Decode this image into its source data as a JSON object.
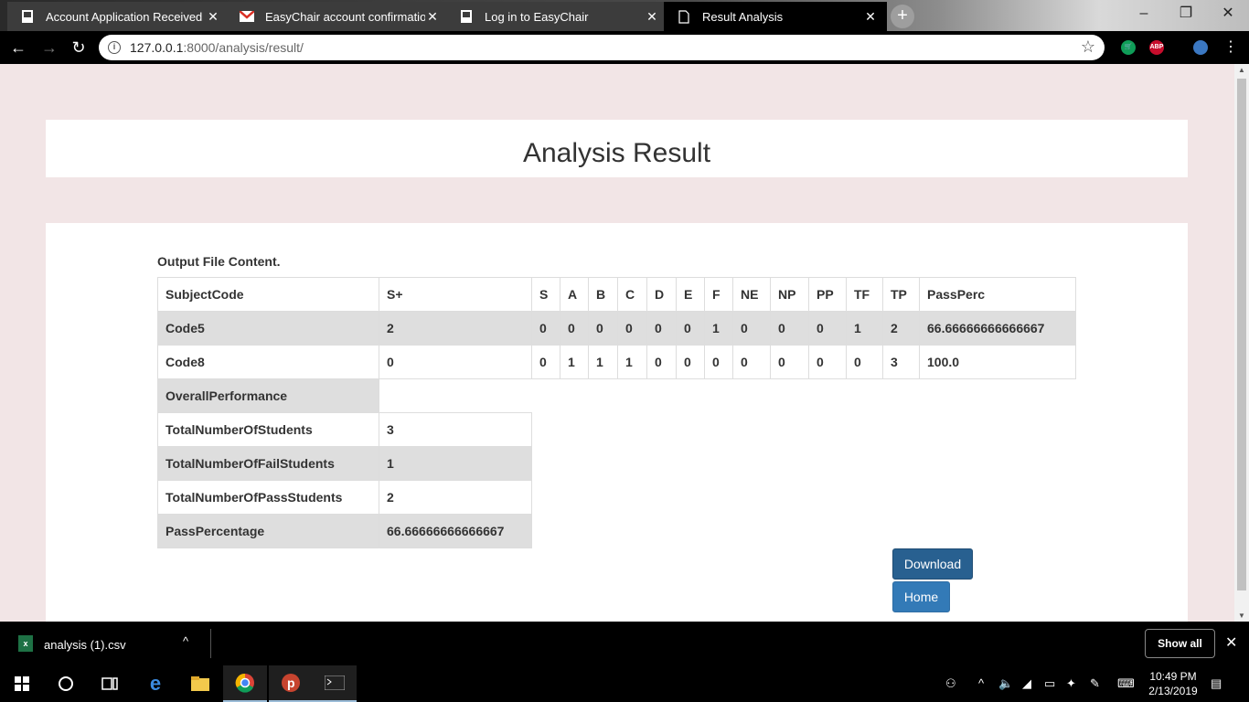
{
  "browser": {
    "tabs": [
      {
        "title": "Account Application Received",
        "icon": "document-icon"
      },
      {
        "title": "EasyChair account confirmation",
        "icon": "gmail-icon"
      },
      {
        "title": "Log in to EasyChair",
        "icon": "document-icon"
      },
      {
        "title": "Result Analysis",
        "icon": "page-icon"
      }
    ],
    "url_host": "127.0.0.1",
    "url_path": ":8000/analysis/result/",
    "ext_abp": "ABP"
  },
  "page": {
    "heading": "Analysis Result",
    "caption": "Output File Content.",
    "table": {
      "headers": [
        "SubjectCode",
        "S+",
        "S",
        "A",
        "B",
        "C",
        "D",
        "E",
        "F",
        "NE",
        "NP",
        "PP",
        "TF",
        "TP",
        "PassPerc"
      ],
      "rows": [
        [
          "Code5",
          "2",
          "0",
          "0",
          "0",
          "0",
          "0",
          "0",
          "1",
          "0",
          "0",
          "0",
          "1",
          "2",
          "66.66666666666667"
        ],
        [
          "Code8",
          "0",
          "0",
          "1",
          "1",
          "1",
          "0",
          "0",
          "0",
          "0",
          "0",
          "0",
          "0",
          "3",
          "100.0"
        ]
      ]
    },
    "summary": {
      "section_label": "OverallPerformance",
      "rows": [
        [
          "TotalNumberOfStudents",
          "3"
        ],
        [
          "TotalNumberOfFailStudents",
          "1"
        ],
        [
          "TotalNumberOfPassStudents",
          "2"
        ],
        [
          "PassPercentage",
          "66.66666666666667"
        ]
      ]
    },
    "buttons": {
      "download": "Download",
      "home": "Home"
    }
  },
  "downloads": {
    "file_name": "analysis (1).csv",
    "file_icon_letter": "x",
    "show_all": "Show all"
  },
  "taskbar": {
    "time": "10:49 PM",
    "date": "2/13/2019"
  },
  "colors": {
    "page_background": "#f2e5e6",
    "shaded_row": "#dedede",
    "download_button": "#286090",
    "home_button": "#337ab7"
  }
}
